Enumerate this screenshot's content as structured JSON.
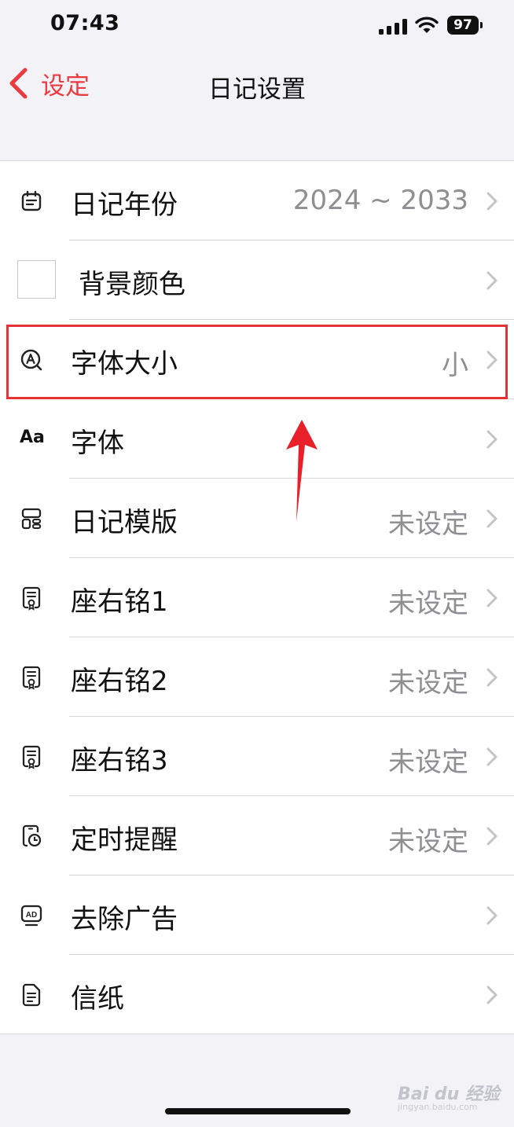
{
  "status_bar": {
    "time": "07:43",
    "battery": "97"
  },
  "nav": {
    "back_label": "设定",
    "title": "日记设置"
  },
  "rows": [
    {
      "label": "日记年份",
      "value": "2024 ~ 2033",
      "icon": "calendar-icon"
    },
    {
      "label": "背景颜色",
      "value": "",
      "icon": "color-swatch"
    },
    {
      "label": "字体大小",
      "value": "小",
      "icon": "font-size-icon"
    },
    {
      "label": "字体",
      "value": "",
      "icon": "font-icon",
      "icon_text": "Aa"
    },
    {
      "label": "日记模版",
      "value": "未设定",
      "icon": "template-icon"
    },
    {
      "label": "座右铭1",
      "value": "未设定",
      "icon": "certificate-icon"
    },
    {
      "label": "座右铭2",
      "value": "未设定",
      "icon": "certificate-icon"
    },
    {
      "label": "座右铭3",
      "value": "未设定",
      "icon": "certificate-icon"
    },
    {
      "label": "定时提醒",
      "value": "未设定",
      "icon": "alarm-phone-icon"
    },
    {
      "label": "去除广告",
      "value": "",
      "icon": "ad-icon",
      "icon_text": "AD"
    },
    {
      "label": "信纸",
      "value": "",
      "icon": "document-icon"
    }
  ],
  "annotation": {
    "highlight_color": "#e53238",
    "highlighted_row": "字体大小"
  },
  "colors": {
    "accent": "#ec3a3f",
    "value_gray": "#8e8e93",
    "background": "#f2f2f7"
  },
  "watermark": {
    "line1": "Bai du 经验",
    "line2": "jingyan.baidu.com"
  }
}
